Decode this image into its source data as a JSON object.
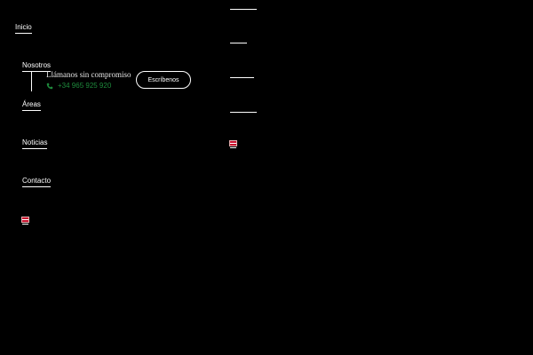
{
  "nav": {
    "items": [
      {
        "label": "Inicio"
      },
      {
        "label": "Nosotros"
      },
      {
        "label": "Áreas"
      },
      {
        "label": "Noticias"
      },
      {
        "label": "Contacto"
      }
    ]
  },
  "contact": {
    "title": "Llámanos sin compromiso",
    "phone": "+34 965 925 920",
    "phone_icon": "phone-icon",
    "cta_label": "Escríbenos"
  },
  "language": {
    "flag_icon": "uk-flag-icon"
  },
  "colors": {
    "background": "#000000",
    "text": "#ffffff",
    "phone_accent": "#1e8a3c"
  }
}
